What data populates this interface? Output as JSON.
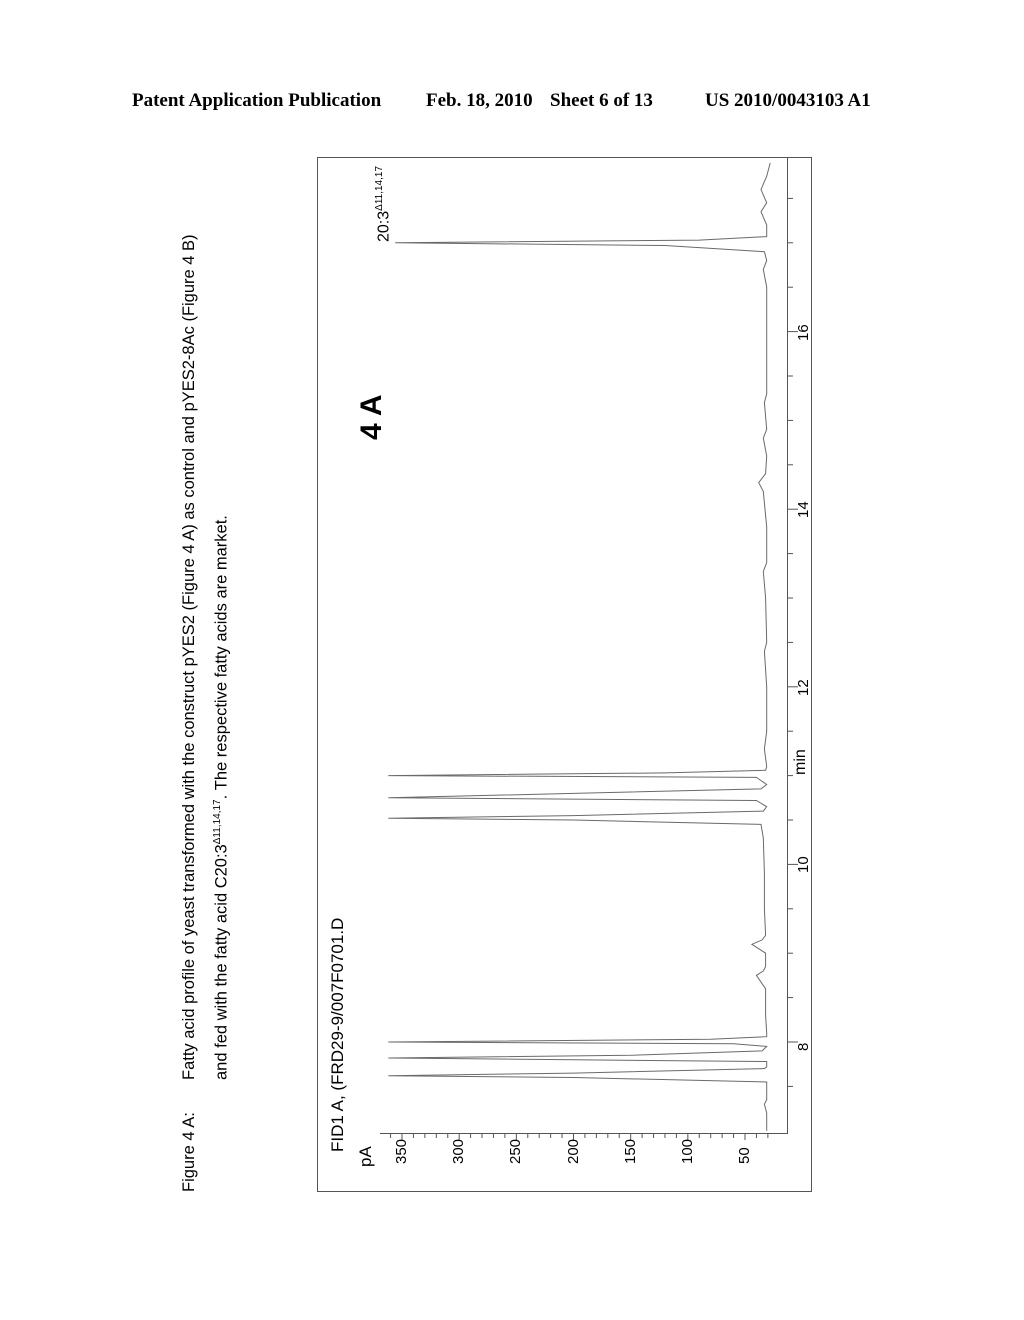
{
  "header": {
    "left": "Patent Application Publication",
    "date": "Feb. 18, 2010",
    "sheet": "Sheet 6 of 13",
    "number": "US 2010/0043103 A1"
  },
  "caption": {
    "label": "Figure 4 A:",
    "line1": "Fatty acid profile of yeast transformed with the construct pYES2 (Figure 4 A) as control and pYES2-8Ac (Figure 4 B)",
    "line2_pre": "and fed with the fatty acid C20:3",
    "line2_sup": "Δ11,14,17",
    "line2_post": ". The respective fatty acids are market."
  },
  "chart_data": {
    "type": "line",
    "title": "FID1 A, (FRD29-9/007F0701.D",
    "panel_label": "4 A",
    "xlabel": "min",
    "ylabel": "pA",
    "xlim": [
      7.0,
      17.95
    ],
    "ylim": [
      20,
      365
    ],
    "x_ticks": [
      8,
      10,
      12,
      14,
      16
    ],
    "y_ticks": [
      50,
      100,
      150,
      200,
      250,
      300,
      350
    ],
    "orientation": "rotated-90-ccw",
    "baseline_pA": 30,
    "annotations": [
      {
        "text": "20:3",
        "sup": "Δ11,14,17",
        "x": 17.0,
        "y": 356
      }
    ],
    "series": [
      {
        "name": "FID1 A",
        "points": [
          [
            7.0,
            31
          ],
          [
            7.2,
            31
          ],
          [
            7.3,
            33
          ],
          [
            7.35,
            31
          ],
          [
            7.45,
            31
          ],
          [
            7.55,
            31
          ],
          [
            7.6,
            200
          ],
          [
            7.62,
            362
          ],
          [
            7.65,
            200
          ],
          [
            7.7,
            33
          ],
          [
            7.72,
            31
          ],
          [
            7.78,
            31
          ],
          [
            7.8,
            200
          ],
          [
            7.82,
            362
          ],
          [
            7.85,
            150
          ],
          [
            7.9,
            35
          ],
          [
            7.95,
            31
          ],
          [
            7.98,
            60
          ],
          [
            8.0,
            362
          ],
          [
            8.03,
            80
          ],
          [
            8.06,
            31
          ],
          [
            8.1,
            31
          ],
          [
            8.3,
            32
          ],
          [
            8.6,
            32
          ],
          [
            8.75,
            40
          ],
          [
            8.8,
            34
          ],
          [
            8.85,
            32
          ],
          [
            9.0,
            32
          ],
          [
            9.1,
            44
          ],
          [
            9.15,
            35
          ],
          [
            9.2,
            32
          ],
          [
            9.5,
            33
          ],
          [
            9.9,
            33
          ],
          [
            10.3,
            34
          ],
          [
            10.45,
            36
          ],
          [
            10.5,
            200
          ],
          [
            10.52,
            362
          ],
          [
            10.55,
            200
          ],
          [
            10.6,
            34
          ],
          [
            10.65,
            31
          ],
          [
            10.72,
            40
          ],
          [
            10.75,
            362
          ],
          [
            10.8,
            200
          ],
          [
            10.85,
            36
          ],
          [
            10.9,
            31
          ],
          [
            10.98,
            40
          ],
          [
            11.0,
            362
          ],
          [
            11.03,
            120
          ],
          [
            11.06,
            32
          ],
          [
            11.1,
            31
          ],
          [
            11.3,
            33
          ],
          [
            11.5,
            31
          ],
          [
            12.0,
            31
          ],
          [
            12.4,
            33
          ],
          [
            12.5,
            31
          ],
          [
            13.0,
            32
          ],
          [
            13.3,
            34
          ],
          [
            13.4,
            31
          ],
          [
            13.8,
            31
          ],
          [
            14.2,
            34
          ],
          [
            14.3,
            38
          ],
          [
            14.4,
            32
          ],
          [
            14.6,
            31
          ],
          [
            14.8,
            34
          ],
          [
            14.9,
            31
          ],
          [
            15.2,
            33
          ],
          [
            15.3,
            31
          ],
          [
            15.8,
            31
          ],
          [
            16.0,
            31
          ],
          [
            16.5,
            31
          ],
          [
            16.7,
            34
          ],
          [
            16.8,
            31
          ],
          [
            16.9,
            33
          ],
          [
            16.97,
            120
          ],
          [
            17.0,
            356
          ],
          [
            17.03,
            90
          ],
          [
            17.07,
            31
          ],
          [
            17.2,
            31
          ],
          [
            17.35,
            36
          ],
          [
            17.45,
            31
          ],
          [
            17.6,
            36
          ],
          [
            17.75,
            31
          ],
          [
            17.9,
            28
          ]
        ]
      }
    ]
  }
}
